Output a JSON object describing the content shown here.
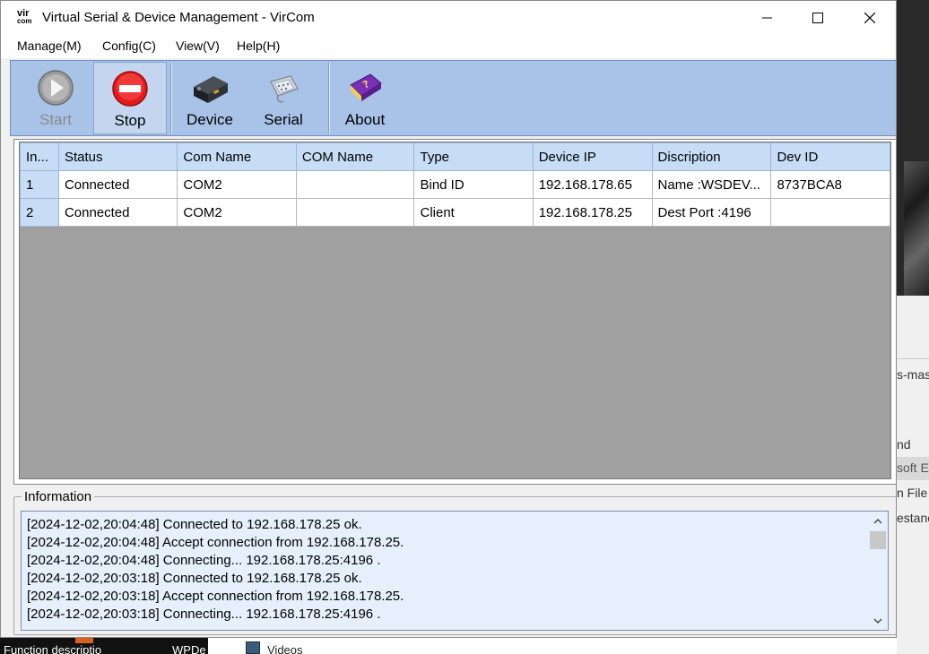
{
  "window": {
    "logo_top": "vir",
    "logo_bottom": "com",
    "title": "Virtual Serial & Device Management - VirCom"
  },
  "menu": [
    {
      "label": "Manage(M)"
    },
    {
      "label": "Config(C)"
    },
    {
      "label": "View(V)"
    },
    {
      "label": "Help(H)"
    }
  ],
  "toolbar": {
    "start": {
      "label": "Start",
      "icon": "play-icon",
      "enabled": false
    },
    "stop": {
      "label": "Stop",
      "icon": "stop-icon",
      "pressed": true
    },
    "device": {
      "label": "Device",
      "icon": "device-icon"
    },
    "serial": {
      "label": "Serial",
      "icon": "serial-port-icon"
    },
    "about": {
      "label": "About",
      "icon": "help-book-icon"
    }
  },
  "table": {
    "columns": [
      "In...",
      "Status",
      "Com Name",
      "COM Name",
      "Type",
      "Device IP",
      "Discription",
      "Dev ID"
    ],
    "rows": [
      {
        "index": "1",
        "status": "Connected",
        "com_name": "COM2",
        "com_name2": "",
        "type": "Bind ID",
        "device_ip": "192.168.178.65",
        "description": "Name :WSDEV...",
        "dev_id": "8737BCA8"
      },
      {
        "index": "2",
        "status": "Connected",
        "com_name": "COM2",
        "com_name2": "",
        "type": "Client",
        "device_ip": "192.168.178.25",
        "description": "Dest Port :4196",
        "dev_id": ""
      }
    ]
  },
  "info": {
    "title": "Information",
    "lines": [
      "[2024-12-02,20:04:48] Connected to 192.168.178.25 ok.",
      "[2024-12-02,20:04:48] Accept connection from 192.168.178.25.",
      "[2024-12-02,20:04:48] Connecting... 192.168.178.25:4196 .",
      "[2024-12-02,20:03:18] Connected to 192.168.178.25 ok.",
      "[2024-12-02,20:03:18] Accept connection from 192.168.178.25.",
      "[2024-12-02,20:03:18] Connecting... 192.168.178.25:4196 ."
    ]
  },
  "background": {
    "right_fragments": [
      "s-mas",
      "nd",
      "soft E",
      "n File",
      "estanc"
    ],
    "bottom_fragments": [
      "Function descriptio",
      "WPDe",
      "Videos"
    ],
    "left_char": "F"
  },
  "colors": {
    "toolbar_bg": "#a9c3e8",
    "header_bg": "#c6ddf5",
    "log_bg": "#e6f0fc",
    "grid_empty": "#a0a0a0"
  }
}
